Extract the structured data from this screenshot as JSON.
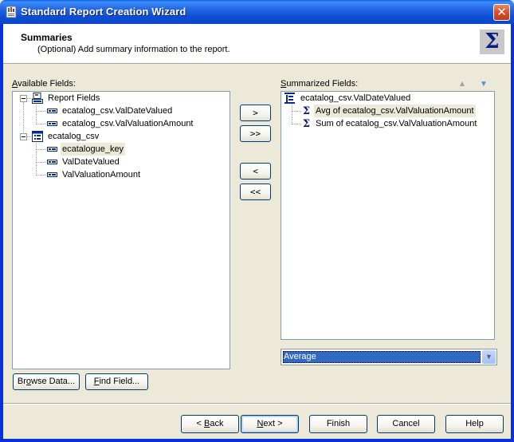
{
  "window": {
    "title": "Standard Report Creation Wizard",
    "close_label": "✕"
  },
  "header": {
    "title": "Summaries",
    "subtitle": "(Optional) Add summary information to the report.",
    "icon": "Σ"
  },
  "available": {
    "label": "Available Fields:",
    "label_accel": "A",
    "label_rest": "vailable Fields:",
    "tree": [
      {
        "label": "Report Fields",
        "icon": "report-fields-icon",
        "level": 0,
        "expanded": true
      },
      {
        "label": "ecatalog_csv.ValDateValued",
        "icon": "field-icon",
        "level": 1
      },
      {
        "label": "ecatalog_csv.ValValuationAmount",
        "icon": "field-icon",
        "level": 1
      },
      {
        "label": "ecatalog_csv",
        "icon": "table-icon",
        "level": 0,
        "expanded": true
      },
      {
        "label": "ecatalogue_key",
        "icon": "field-icon",
        "level": 1,
        "selected": true
      },
      {
        "label": "ValDateValued",
        "icon": "field-icon",
        "level": 1
      },
      {
        "label": "ValValuationAmount",
        "icon": "field-icon",
        "level": 1
      }
    ]
  },
  "transfer": {
    "add": ">",
    "add_all": ">>",
    "remove": "<",
    "remove_all": "<<"
  },
  "summarized": {
    "label_accel": "S",
    "label_rest": "ummarized Fields:",
    "tree": [
      {
        "label": "ecatalog_csv.ValDateValued",
        "icon": "group-icon",
        "level": 0
      },
      {
        "label": "Avg of ecatalog_csv.ValValuationAmount",
        "icon": "sigma-icon",
        "level": 1,
        "selected": true
      },
      {
        "label": "Sum of ecatalog_csv.ValValuationAmount",
        "icon": "sigma-icon",
        "level": 1
      }
    ],
    "move_up": "▲",
    "move_down": "▼",
    "summary_type": "Average"
  },
  "buttons": {
    "browse_pre": "Br",
    "browse_accel": "o",
    "browse_post": "wse Data...",
    "find_accel": "F",
    "find_post": "ind Field...",
    "back_pre": "< ",
    "back_accel": "B",
    "back_post": "ack",
    "next_accel": "N",
    "next_post": "ext >",
    "finish": "Finish",
    "cancel": "Cancel",
    "help": "Help"
  },
  "colors": {
    "titlebar": "#0b4fd5",
    "selection": "#316ac5",
    "sigma": "#0a1a7e"
  }
}
